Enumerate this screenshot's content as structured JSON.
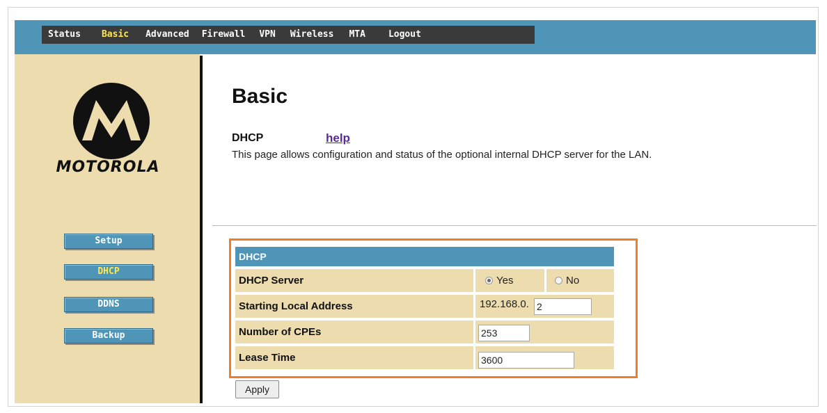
{
  "nav": {
    "items": [
      "Status",
      "Basic",
      "Advanced",
      "Firewall",
      "VPN",
      "Wireless",
      "MTA",
      "Logout"
    ],
    "active": "Basic"
  },
  "sidebar": {
    "logo_text": "MOTOROLA",
    "items": [
      "Setup",
      "DHCP",
      "DDNS",
      "Backup"
    ],
    "active": "DHCP"
  },
  "main": {
    "title": "Basic",
    "section": "DHCP",
    "help_link": "help",
    "description": "This page allows configuration and status of the optional internal DHCP server for the LAN."
  },
  "form": {
    "header": "DHCP",
    "dhcp_server_label": "DHCP Server",
    "yes_label": "Yes",
    "no_label": "No",
    "dhcp_server_selected": "Yes",
    "start_address_label": "Starting Local Address",
    "start_address_prefix": "192.168.0.",
    "start_address_value": "2",
    "cpes_label": "Number of CPEs",
    "cpes_value": "253",
    "lease_label": "Lease Time",
    "lease_value": "3600",
    "apply_label": "Apply"
  },
  "colors": {
    "bar_blue": "#4f95b7",
    "sidebar_tan": "#ecdcae",
    "highlight_orange": "#f07e26",
    "active_yellow": "#ffe84a"
  }
}
